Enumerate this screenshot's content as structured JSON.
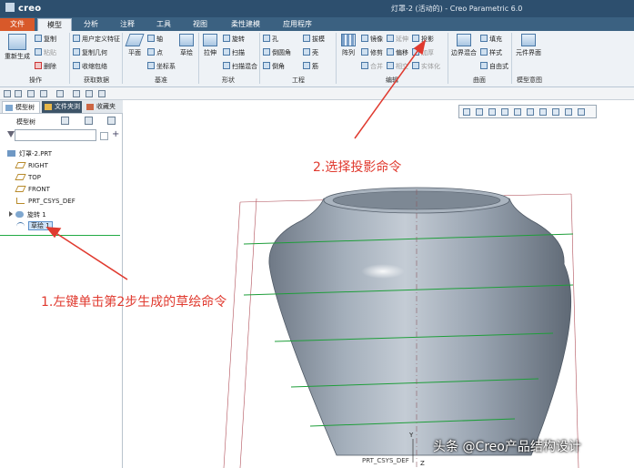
{
  "window": {
    "app_name": "creo",
    "title": "灯罩-2 (活动的) - Creo Parametric 6.0"
  },
  "ribbon_tabs": [
    "文件",
    "模型",
    "分析",
    "注释",
    "工具",
    "视图",
    "柔性建模",
    "应用程序"
  ],
  "ribbon": {
    "operations": {
      "regenerate": "重新生成",
      "copy": "复制",
      "paste": "粘贴",
      "delete": "删除",
      "group": "操作"
    },
    "get_data": {
      "udf": "用户定义特征",
      "copy_geom": "复制几何",
      "shrinkwrap": "收缩包络",
      "group": "获取数据"
    },
    "datum": {
      "plane": "平面",
      "axis": "轴",
      "point": "点",
      "csys": "坐标系",
      "sketch": "草绘",
      "group": "基准"
    },
    "shapes": {
      "extrude": "拉伸",
      "revolve": "旋转",
      "sweep": "扫描",
      "swept_blend": "扫描混合",
      "group": "形状"
    },
    "engineering": {
      "hole": "孔",
      "round": "倒圆角",
      "chamfer": "倒角",
      "draft": "拔模",
      "shell": "壳",
      "rib": "筋",
      "group": "工程"
    },
    "editing": {
      "pattern": "阵列",
      "mirror": "镜像",
      "extend": "延伸",
      "project": "投影",
      "trim": "修剪",
      "offset": "偏移",
      "thicken": "加厚",
      "merge": "合并",
      "intersect": "相交",
      "solidify": "实体化",
      "group": "编辑"
    },
    "surfaces": {
      "boundary_blend": "边界混合",
      "fill": "填充",
      "style": "样式",
      "freestyle": "自由式",
      "group": "曲面"
    },
    "model_intent": {
      "component_interface": "元件界面",
      "group": "模型意图"
    }
  },
  "left_panel": {
    "tabs": [
      "模型树",
      "文件夹浏",
      "收藏夹"
    ],
    "tree_title": "模型树",
    "items": [
      "灯罩-2.PRT",
      "RIGHT",
      "TOP",
      "FRONT",
      "PRT_CSYS_DEF",
      "旋转 1",
      "草绘 1"
    ]
  },
  "viewport": {
    "csys_label": "PRT_CSYS_DEF",
    "axis_y": "Y",
    "axis_z": "Z"
  },
  "annotations": {
    "step1": "1.左键单击第2步生成的草绘命令",
    "step2": "2.选择投影命令"
  },
  "watermark": "头条 @Creo产品结构设计",
  "colors": {
    "annotation": "#e03a2f",
    "title_bar": "#2d4f6e",
    "file_tab": "#d8592a",
    "model": "#9ca7b3"
  }
}
